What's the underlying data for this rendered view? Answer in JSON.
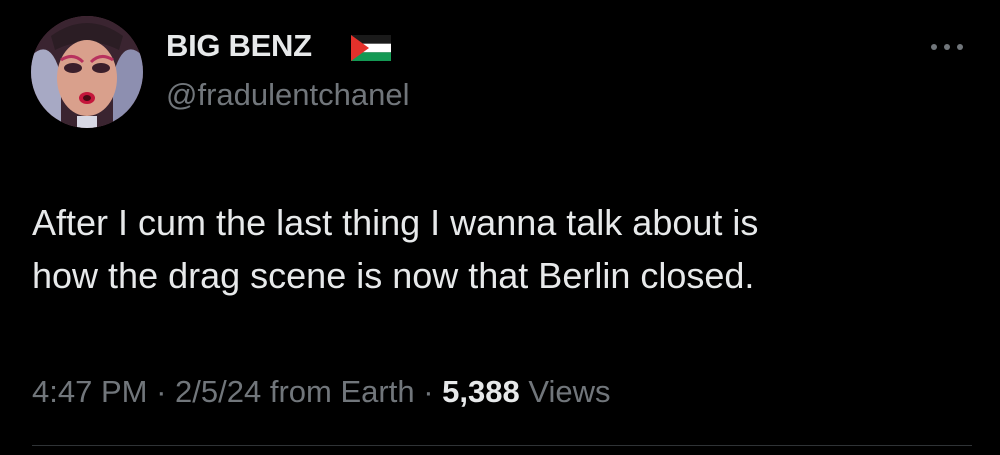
{
  "author": {
    "display_name": "BIG BENZ",
    "handle": "@fradulentchanel",
    "flag_icon": "palestine-flag-icon"
  },
  "tweet": {
    "text_lines": [
      "After I cum the last thing I wanna talk about is",
      "how the drag scene is now that Berlin closed."
    ]
  },
  "meta": {
    "time": "4:47 PM",
    "separator": "·",
    "date": "2/5/24",
    "source": "from Earth",
    "views_count": "5,388",
    "views_label": "Views"
  },
  "colors": {
    "background": "#000000",
    "primary_text": "#e7e9ea",
    "secondary_text": "#71767b",
    "divider": "#2f3336"
  }
}
